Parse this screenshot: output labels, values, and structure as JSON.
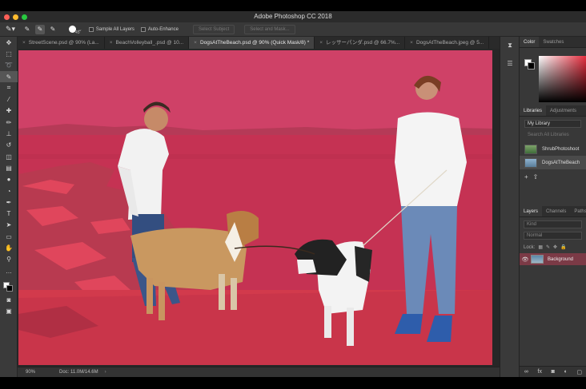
{
  "window": {
    "app_title": "Adobe Photoshop CC 2018",
    "traffic_colors": {
      "close": "#fe5f57",
      "minimize": "#febc2e",
      "zoom": "#28c840"
    }
  },
  "options_bar": {
    "tool_icon": "quick-selection-icon",
    "mode_icons": [
      "new-selection-icon",
      "add-to-selection-icon",
      "subtract-from-selection-icon"
    ],
    "brush_size": "45",
    "sample_all_layers": {
      "label": "Sample All Layers",
      "checked": false
    },
    "auto_enhance": {
      "label": "Auto-Enhance",
      "checked": false
    },
    "select_subject_label": "Select Subject",
    "select_and_mask_label": "Select and Mask..."
  },
  "tabs": [
    {
      "label": "StreetScene.psd @ 90% (La...",
      "active": false
    },
    {
      "label": "BeachVolleyball_.psd @ 10...",
      "active": false
    },
    {
      "label": "DogsAtTheBeach.psd @ 90% (Quick Mask/8) *",
      "active": true
    },
    {
      "label": "レッサーパンダ.psd @ 66.7%...",
      "active": false
    },
    {
      "label": "DogsAtTheBeach.jpeg @ 5...",
      "active": false
    }
  ],
  "tools": [
    {
      "name": "move-tool-icon",
      "glyph": "✥"
    },
    {
      "name": "marquee-tool-icon",
      "glyph": "⬚"
    },
    {
      "name": "lasso-tool-icon",
      "glyph": "➰"
    },
    {
      "name": "quick-selection-tool-icon",
      "glyph": "✎",
      "active": true
    },
    {
      "name": "crop-tool-icon",
      "glyph": "⌗"
    },
    {
      "name": "eyedropper-tool-icon",
      "glyph": "⁄"
    },
    {
      "name": "healing-brush-tool-icon",
      "glyph": "✚"
    },
    {
      "name": "brush-tool-icon",
      "glyph": "✏"
    },
    {
      "name": "clone-stamp-tool-icon",
      "glyph": "⊥"
    },
    {
      "name": "history-brush-tool-icon",
      "glyph": "↺"
    },
    {
      "name": "eraser-tool-icon",
      "glyph": "◫"
    },
    {
      "name": "gradient-tool-icon",
      "glyph": "▤"
    },
    {
      "name": "blur-tool-icon",
      "glyph": "●"
    },
    {
      "name": "dodge-tool-icon",
      "glyph": "◔"
    },
    {
      "name": "pen-tool-icon",
      "glyph": "✒"
    },
    {
      "name": "type-tool-icon",
      "glyph": "T"
    },
    {
      "name": "path-selection-tool-icon",
      "glyph": "➤"
    },
    {
      "name": "rectangle-tool-icon",
      "glyph": "▭"
    },
    {
      "name": "hand-tool-icon",
      "glyph": "✋"
    },
    {
      "name": "zoom-tool-icon",
      "glyph": "⚲"
    },
    {
      "name": "more-tools-icon",
      "glyph": "…"
    }
  ],
  "toolbar_bottom": [
    {
      "name": "quick-mask-icon",
      "glyph": "◙"
    },
    {
      "name": "screen-mode-icon",
      "glyph": "▣"
    }
  ],
  "status": {
    "zoom": "90%",
    "doc": "Doc: 11.0M/14.6M",
    "arrow": "›"
  },
  "dock_icons": [
    {
      "name": "history-panel-icon",
      "glyph": "⧗"
    },
    {
      "name": "properties-panel-icon",
      "glyph": "☰"
    }
  ],
  "color_panel": {
    "tabs": [
      {
        "label": "Color",
        "active": true
      },
      {
        "label": "Swatches",
        "active": false
      }
    ],
    "foreground": "#ffffff",
    "background": "#000000",
    "hue": "#e31b2d"
  },
  "libraries_panel": {
    "tabs": [
      {
        "label": "Libraries",
        "active": true
      },
      {
        "label": "Adjustments",
        "active": false
      }
    ],
    "library": "My Library",
    "search_placeholder": "Search All Libraries",
    "items": [
      {
        "label": "ShrubPhotoshoot",
        "active": false
      },
      {
        "label": "DogsAtTheBeach",
        "active": true
      }
    ]
  },
  "layers_panel": {
    "tabs": [
      {
        "label": "Layers",
        "active": true
      },
      {
        "label": "Channels",
        "active": false
      },
      {
        "label": "Paths",
        "active": false
      }
    ],
    "kind_placeholder": "Kind",
    "blend_mode": "Normal",
    "opacity_label": "O",
    "lock_label": "Lock:",
    "layers": [
      {
        "name": "Background",
        "visible": true
      }
    ]
  },
  "colors": {
    "quick_mask": "#c2384f",
    "ui_dark": "#383838"
  }
}
